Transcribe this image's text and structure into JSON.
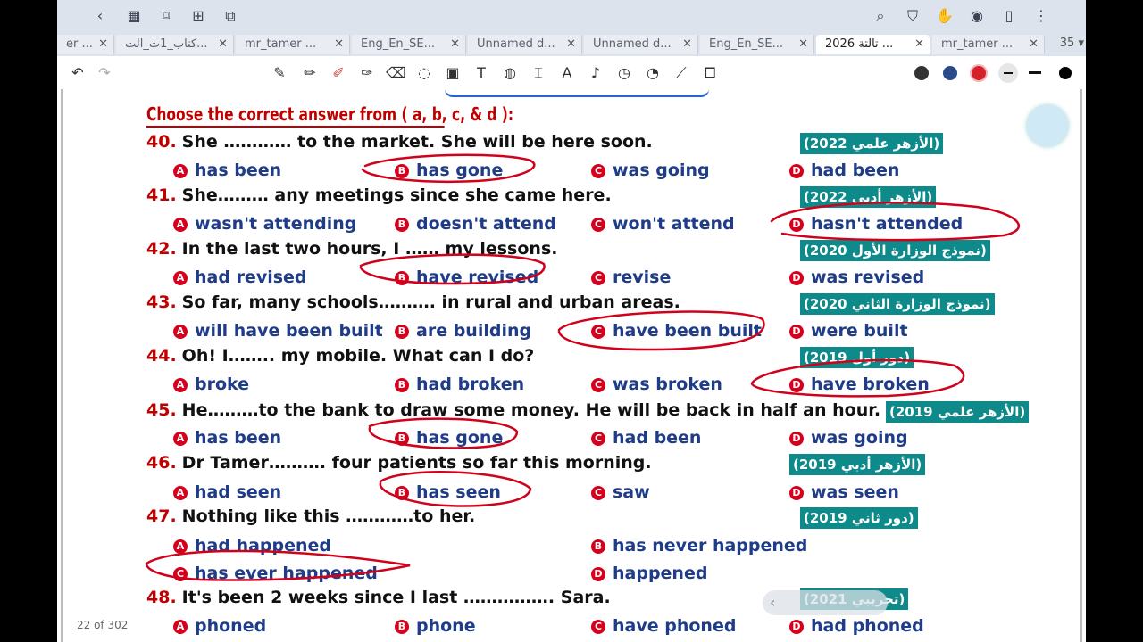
{
  "tabs": [
    {
      "label": "er ...",
      "active": false
    },
    {
      "label": "كتاب_1ث_الت...",
      "active": false
    },
    {
      "label": "mr_tamer ...",
      "active": false
    },
    {
      "label": "Eng_En_SE...",
      "active": false
    },
    {
      "label": "Unnamed d...",
      "active": false
    },
    {
      "label": "Unnamed d...",
      "active": false
    },
    {
      "label": "Eng_En_SE...",
      "active": false
    },
    {
      "label": "تالتة 2026 ...",
      "active": true
    },
    {
      "label": "mr_tamer ...",
      "active": false
    }
  ],
  "tab_count": "35",
  "heading": "Choose the correct answer from ( a, b, c, & d ):",
  "questions": [
    {
      "num": "40.",
      "text": "She ………… to the market. She will be here soon.",
      "tag": "(الأزهر علمي 2022)",
      "options": [
        {
          "badge": "A",
          "text": "has been"
        },
        {
          "badge": "B",
          "text": "has gone"
        },
        {
          "badge": "C",
          "text": "was going"
        },
        {
          "badge": "D",
          "text": "had been"
        }
      ]
    },
    {
      "num": "41.",
      "text": "She……… any meetings since she came here.",
      "tag": "(الأزهر أدبي 2022)",
      "options": [
        {
          "badge": "A",
          "text": "wasn't attending"
        },
        {
          "badge": "B",
          "text": "doesn't attend"
        },
        {
          "badge": "C",
          "text": "won't attend"
        },
        {
          "badge": "D",
          "text": "hasn't attended"
        }
      ]
    },
    {
      "num": "42.",
      "text": "In the last two hours, I …… my lessons.",
      "tag": "(نموذج الوزارة الأول 2020)",
      "options": [
        {
          "badge": "A",
          "text": "had revised"
        },
        {
          "badge": "B",
          "text": "have revised"
        },
        {
          "badge": "C",
          "text": "revise"
        },
        {
          "badge": "D",
          "text": "was revised"
        }
      ]
    },
    {
      "num": "43.",
      "text": "So far, many schools………. in rural and urban areas.",
      "tag": "(نموذج الوزارة الثاني 2020)",
      "options": [
        {
          "badge": "A",
          "text": "will have been built"
        },
        {
          "badge": "B",
          "text": "are building"
        },
        {
          "badge": "C",
          "text": "have been built"
        },
        {
          "badge": "D",
          "text": "were built"
        }
      ]
    },
    {
      "num": "44.",
      "text": "Oh! I…….. my mobile. What can I do?",
      "tag": "(دور أول 2019)",
      "options": [
        {
          "badge": "A",
          "text": "broke"
        },
        {
          "badge": "B",
          "text": "had broken"
        },
        {
          "badge": "C",
          "text": "was broken"
        },
        {
          "badge": "D",
          "text": "have broken"
        }
      ]
    },
    {
      "num": "45.",
      "text": "He………to the bank to draw some money. He will be back in half an hour.",
      "tag": "(الأزهر علمي 2019)",
      "options": [
        {
          "badge": "A",
          "text": "has been"
        },
        {
          "badge": "B",
          "text": "has gone"
        },
        {
          "badge": "C",
          "text": "had been"
        },
        {
          "badge": "D",
          "text": "was going"
        }
      ]
    },
    {
      "num": "46.",
      "text": "Dr Tamer………. four patients so far this morning.",
      "tag": "(الأزهر أدبي 2019)",
      "options": [
        {
          "badge": "A",
          "text": "had seen"
        },
        {
          "badge": "B",
          "text": "has seen"
        },
        {
          "badge": "C",
          "text": "saw"
        },
        {
          "badge": "D",
          "text": "was seen"
        }
      ]
    },
    {
      "num": "47.",
      "text": "Nothing like this …………to her.",
      "tag": "(دور ثاني 2019)",
      "options": [
        {
          "badge": "A",
          "text": "had happened"
        },
        {
          "badge": "B",
          "text": "has never happened"
        },
        {
          "badge": "C",
          "text": "has ever happened"
        },
        {
          "badge": "D",
          "text": "happened"
        }
      ]
    },
    {
      "num": "48.",
      "text": "It's been 2 weeks since I last ……………. Sara.",
      "tag": "(تجريبي 2021)",
      "options": [
        {
          "badge": "A",
          "text": "phoned"
        },
        {
          "badge": "B",
          "text": "phone"
        },
        {
          "badge": "C",
          "text": "have phoned"
        },
        {
          "badge": "D",
          "text": "had phoned"
        }
      ]
    }
  ],
  "page_indicator": "22 of 302",
  "pen_colors": [
    "#333333",
    "#2a4a8a",
    "#d6202a",
    "#e6e6e6",
    "#111111",
    "#000000"
  ],
  "annotation_color": "#d0021b"
}
